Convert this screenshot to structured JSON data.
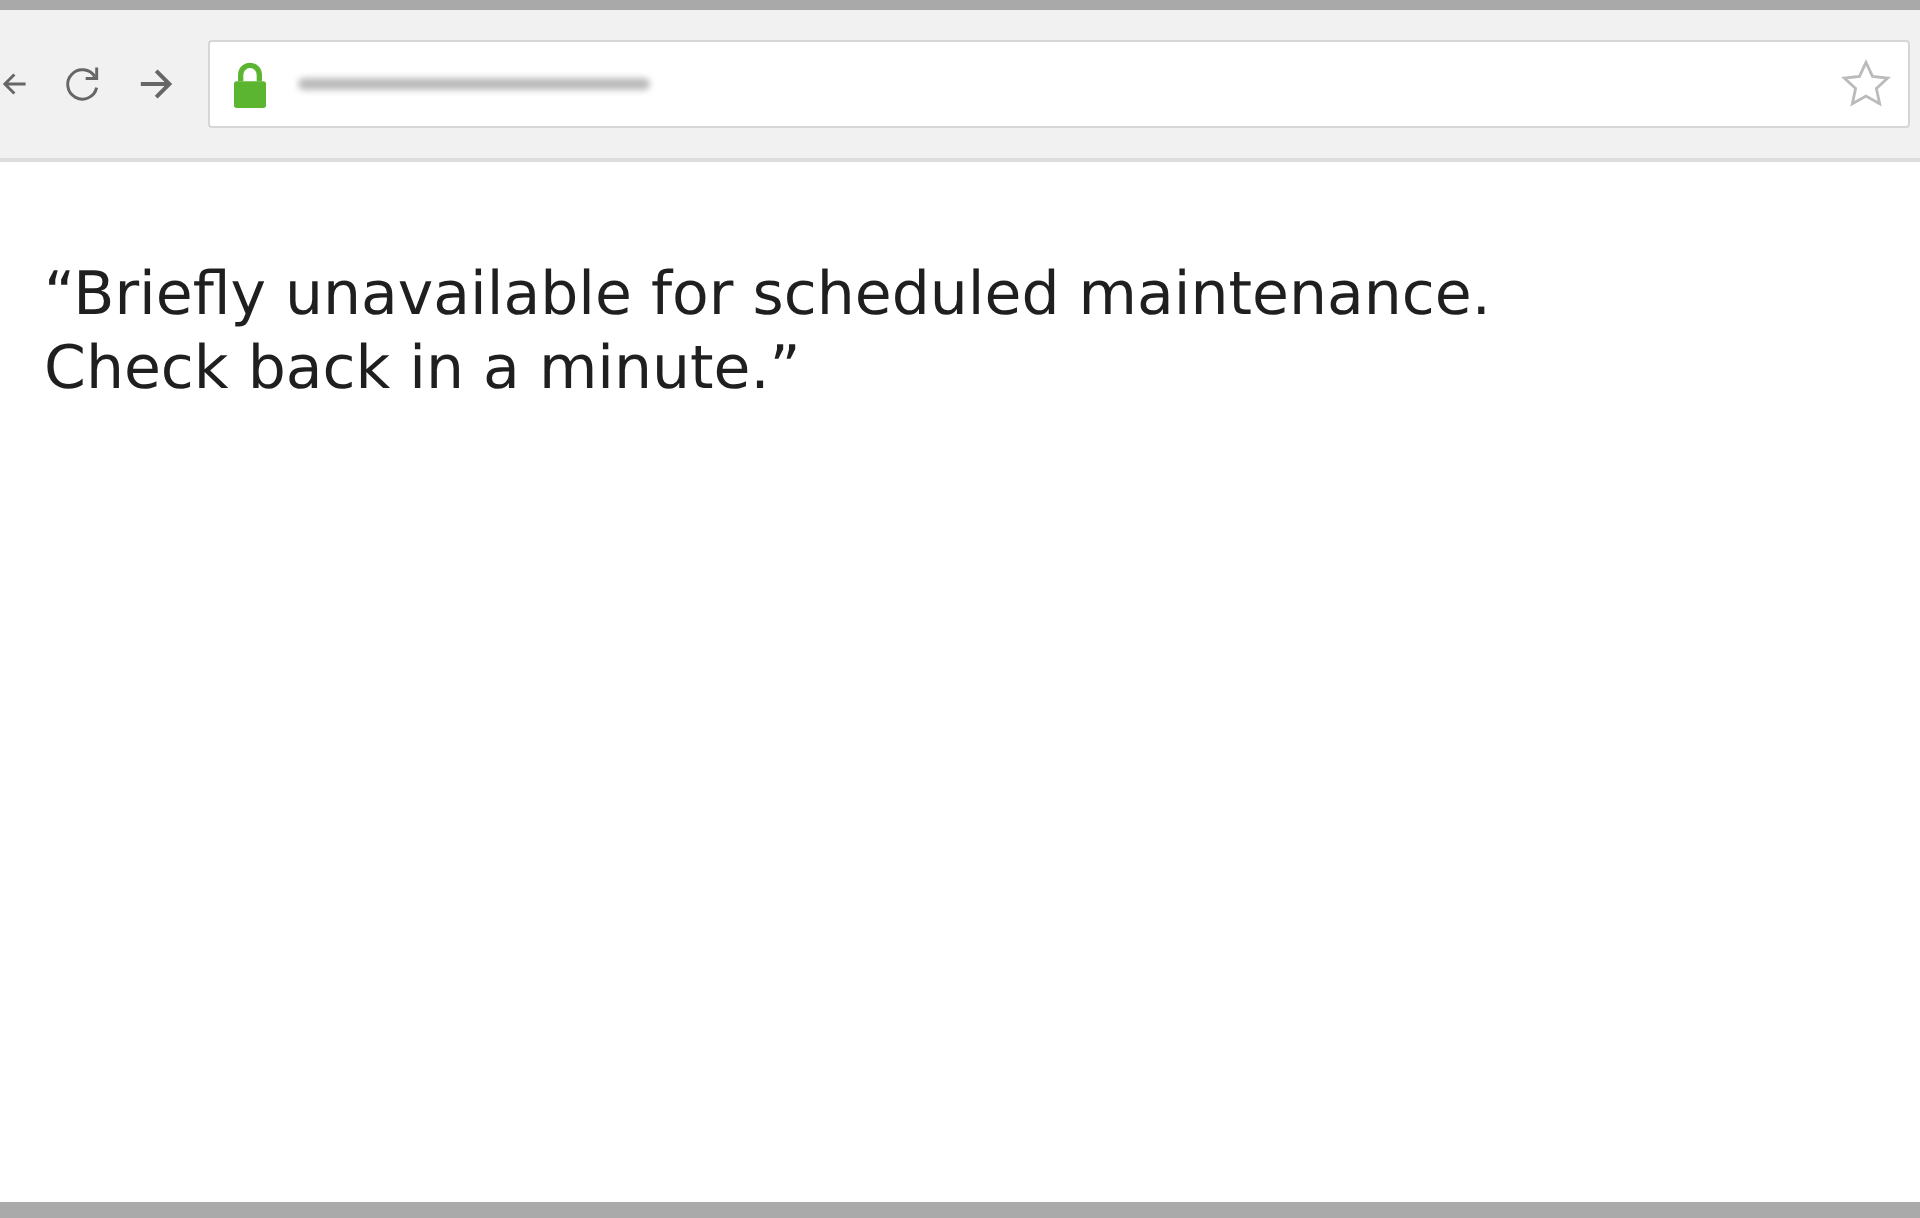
{
  "browser": {
    "secure": true,
    "bookmarked": false
  },
  "page": {
    "message": "“Briefly unavailable for scheduled maintenance. Check back in a minute.”"
  }
}
